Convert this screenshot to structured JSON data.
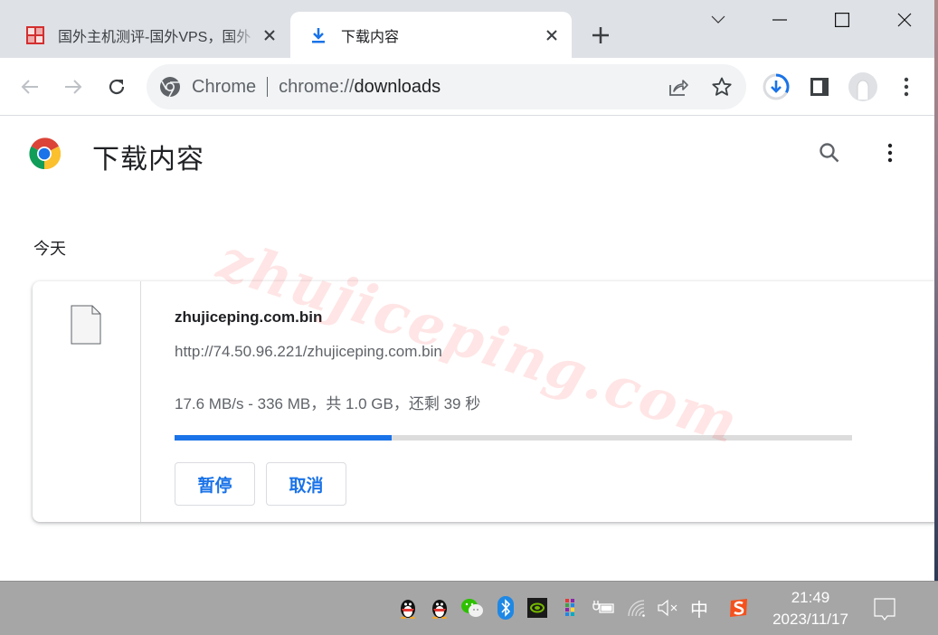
{
  "tabs": [
    {
      "title": "国外主机测评-国外VPS，国外",
      "favicon": "site-seal-icon",
      "active": false
    },
    {
      "title": "下载内容",
      "favicon": "download-icon",
      "active": true
    }
  ],
  "window_controls": [
    "tab-search",
    "minimize",
    "maximize",
    "close"
  ],
  "toolbar": {
    "omnibox_chip": "Chrome",
    "url_prefix": "chrome://",
    "url_path": "downloads",
    "download_progress_fraction": 0.33
  },
  "page": {
    "title": "下载内容",
    "section_date": "今天"
  },
  "download": {
    "file_name": "zhujiceping.com.bin",
    "url": "http://74.50.96.221/zhujiceping.com.bin",
    "status": "17.6 MB/s - 336 MB，共 1.0 GB，还剩 39 秒",
    "progress_percent": 32,
    "pause_label": "暂停",
    "cancel_label": "取消"
  },
  "watermark": "zhujiceping.com",
  "taskbar": {
    "tray_icons": [
      "qq-icon",
      "qq-icon",
      "wechat-icon",
      "bluetooth-icon",
      "nvidia-icon",
      "color-app-icon",
      "battery-charging-icon",
      "wifi-icon",
      "volume-muted-icon",
      "ime-chinese-icon",
      "sogou-icon"
    ],
    "ime_label": "中",
    "time": "21:49",
    "date": "2023/11/17"
  },
  "colors": {
    "accent": "#1a73e8",
    "tabstrip_bg": "#dee1e6",
    "taskbar_bg": "#a6a6a6",
    "watermark": "#ff2828"
  }
}
